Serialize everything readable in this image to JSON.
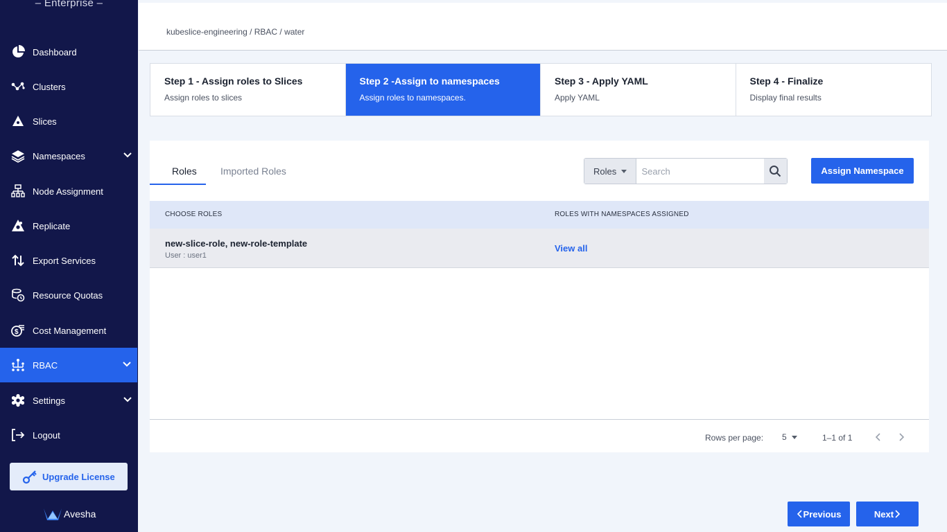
{
  "sidebar": {
    "brand_sub": "– Enterprise –",
    "items": [
      {
        "label": "Dashboard",
        "icon": "pie-chart-icon"
      },
      {
        "label": "Clusters",
        "icon": "network-icon"
      },
      {
        "label": "Slices",
        "icon": "slice-icon"
      },
      {
        "label": "Namespaces",
        "icon": "layers-icon"
      },
      {
        "label": "Node Assignment",
        "icon": "hierarchy-icon"
      },
      {
        "label": "Replicate",
        "icon": "replicate-icon"
      },
      {
        "label": "Export Services",
        "icon": "swap-vertical-icon"
      },
      {
        "label": "Resource Quotas",
        "icon": "quota-icon"
      },
      {
        "label": "Cost Management",
        "icon": "coins-icon"
      },
      {
        "label": "RBAC",
        "icon": "rbac-icon",
        "active": true
      },
      {
        "label": "Settings",
        "icon": "gear-icon"
      },
      {
        "label": "Logout",
        "icon": "logout-icon"
      }
    ],
    "upgrade_label": "Upgrade License",
    "logo_text": "Avesha"
  },
  "header": {
    "breadcrumb": "kubeslice-engineering / RBAC / water"
  },
  "stepper": [
    {
      "title": "Step 1 - Assign roles to Slices",
      "subtitle": "Assign roles to slices"
    },
    {
      "title": "Step 2 -Assign to namespaces",
      "subtitle": "Assign roles to namespaces.",
      "active": true
    },
    {
      "title": "Step 3 - Apply YAML",
      "subtitle": "Apply YAML"
    },
    {
      "title": "Step 4 - Finalize",
      "subtitle": "Display final results"
    }
  ],
  "tabs": {
    "roles": "Roles",
    "imported": "Imported Roles"
  },
  "search": {
    "filter_value": "Roles",
    "placeholder": "Search"
  },
  "assign_button": "Assign Namespace",
  "table": {
    "columns": [
      "CHOOSE ROLES",
      "ROLES WITH NAMESPACES ASSIGNED"
    ],
    "rows": [
      {
        "roles": "new-slice-role, new-role-template",
        "user": "User : user1",
        "action": "View all"
      }
    ]
  },
  "pagination": {
    "rows_per_page_label": "Rows per page:",
    "rows_per_page": "5",
    "range": "1–1 of 1"
  },
  "nav_buttons": {
    "previous": "Previous",
    "next": "Next"
  },
  "colors": {
    "sidebar_bg": "#12174a",
    "accent": "#2563eb"
  }
}
